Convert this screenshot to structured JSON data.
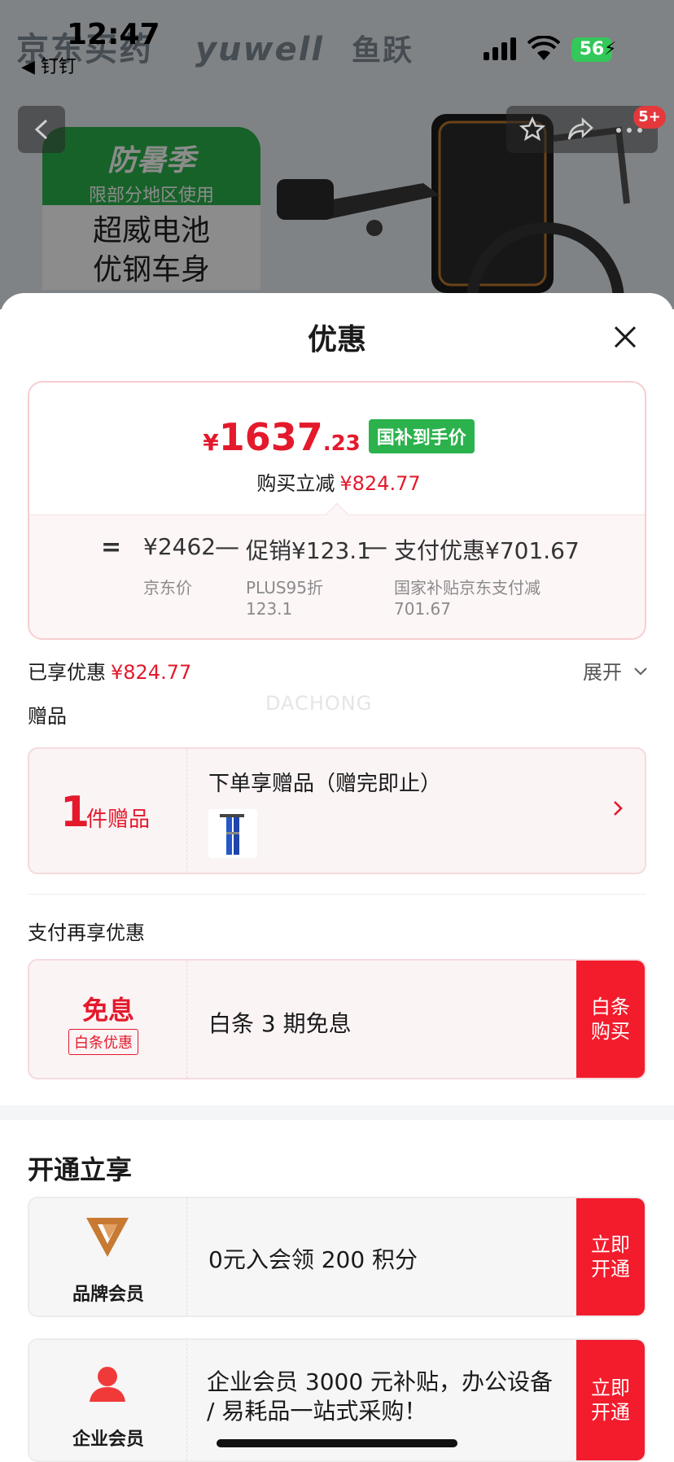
{
  "status_bar": {
    "time": "12:47",
    "back_app": "◀ 钉钉",
    "battery": "56"
  },
  "background": {
    "brand_left": "京东买药",
    "brand_right_en": "yuwell",
    "brand_right_cn": "鱼跃",
    "promo_title": "防暑季",
    "promo_sub": "限部分地区使用",
    "promo_line1": "超威电池",
    "promo_line2": "优钢车身",
    "nav_badge": "5+"
  },
  "sheet": {
    "title": "优惠",
    "price": {
      "yen": "¥",
      "int": "1637",
      "dec": ".23",
      "tag": "国补到手价",
      "reduce_label": "购买立减",
      "reduce_value": "¥824.77"
    },
    "formula": {
      "eq": "=",
      "jd_price": "¥2462",
      "jd_price_label": "京东价",
      "minus1": "—",
      "promo": "促销¥123.1",
      "promo_sub1": "PLUS95折",
      "promo_sub2": "123.1",
      "minus2": "—",
      "pay": "支付优惠¥701.67",
      "pay_sub1": "国家补贴京东支付减",
      "pay_sub2": "701.67"
    },
    "enjoyed_label": "已享优惠",
    "enjoyed_value": "¥824.77",
    "expand_label": "展开",
    "watermark": "DACHONG",
    "gift_heading": "赠品",
    "gift": {
      "count": "1",
      "unit": "件赠品",
      "title": "下单享赠品（赠完即止）"
    },
    "pay_heading": "支付再享优惠",
    "pay_offer": {
      "big": "免息",
      "badge": "白条优惠",
      "text": "白条 3 期免息",
      "button_line1": "白条",
      "button_line2": "购买"
    },
    "open_heading": "开通立享",
    "brand_member": {
      "label": "品牌会员",
      "text": "0元入会领 200 积分",
      "button_line1": "立即",
      "button_line2": "开通"
    },
    "enterprise_member": {
      "label": "企业会员",
      "text": "企业会员 3000 元补贴，办公设备 / 易耗品一站式采购！",
      "button_line1": "立即",
      "button_line2": "开通"
    }
  },
  "colors": {
    "accent_red": "#e4192c",
    "button_red": "#f21c2c",
    "tag_green": "#2bb24c",
    "brand_logo": "#c87a33"
  }
}
